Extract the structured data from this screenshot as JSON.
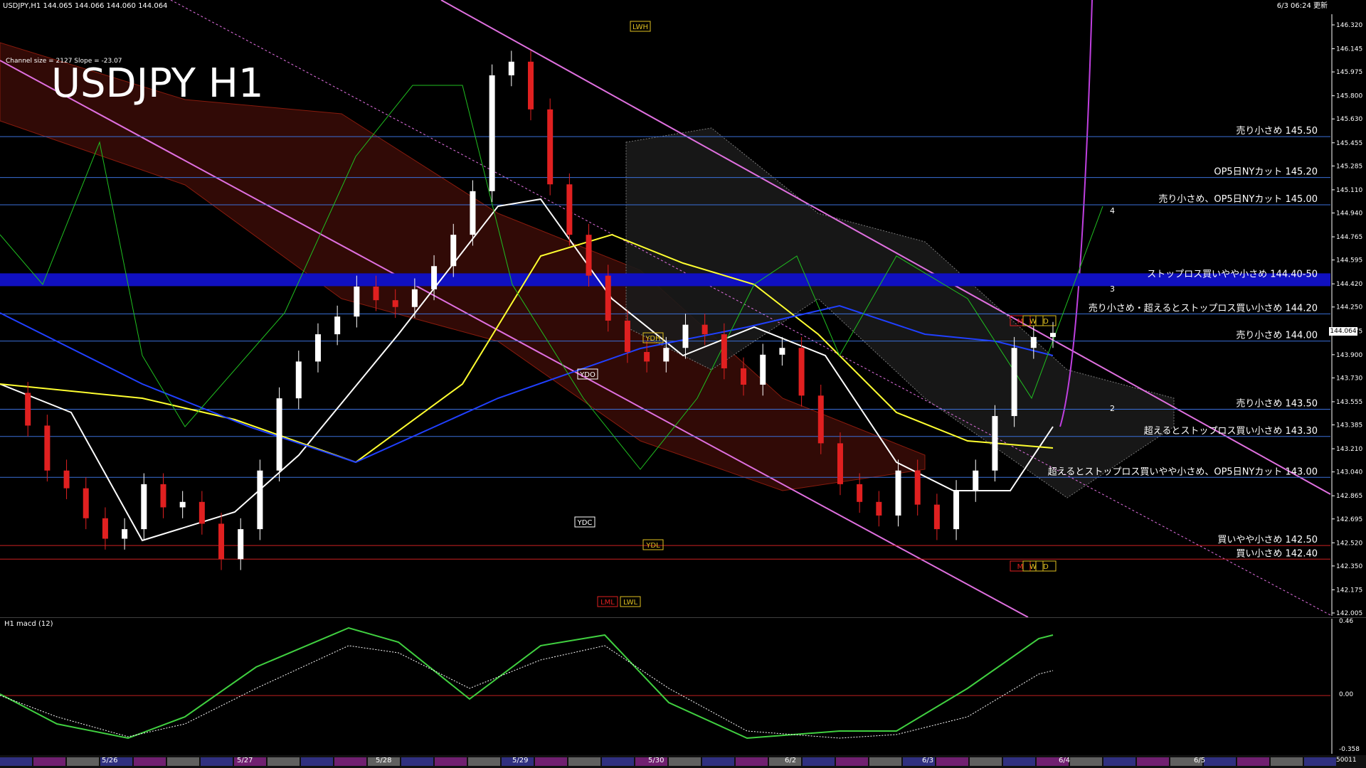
{
  "header": {
    "symbol_line": "USDJPY,H1  144.065 144.066 144.060 144.064",
    "datetime": "6/3 06:24 更新",
    "channel_info": "Channel size = 2127 Slope = -23.07",
    "big_title": "USDJPY H1"
  },
  "macd_panel": {
    "label": "H1  macd (12)",
    "scale": [
      "0.46",
      "0.00",
      "-0.358"
    ]
  },
  "price_badge": "144.064",
  "footer_code": "50011",
  "chart_data": {
    "type": "line",
    "title": "USDJPY H1",
    "y_ticks": [
      "146.320",
      "146.145",
      "145.975",
      "145.800",
      "145.630",
      "145.455",
      "145.285",
      "145.110",
      "144.940",
      "144.765",
      "144.595",
      "144.420",
      "144.250",
      "144.075",
      "143.900",
      "143.730",
      "143.555",
      "143.385",
      "143.210",
      "143.040",
      "142.865",
      "142.695",
      "142.520",
      "142.350",
      "142.175",
      "142.005"
    ],
    "ylim": [
      142.005,
      146.32
    ],
    "x_labels": [
      "5/26",
      "5/27",
      "5/28",
      "5/29",
      "5/30",
      "6/2",
      "6/3",
      "6/4",
      "6/5"
    ],
    "levels": [
      {
        "label": "売り小さめ 145.50",
        "value": 145.5,
        "color": "#3a6fd8"
      },
      {
        "label": "OP5日NYカット 145.20",
        "value": 145.2,
        "color": "#3a6fd8"
      },
      {
        "label": "売り小さめ、OP5日NYカット 145.00",
        "value": 145.0,
        "color": "#3a6fd8"
      },
      {
        "label": "ストップロス買いやや小さめ 144.40-50",
        "value": 144.45,
        "color": "#1a1ad8"
      },
      {
        "label": "売り小さめ・超えるとストップロス買い小さめ 144.20",
        "value": 144.2,
        "color": "#3a6fd8"
      },
      {
        "label": "売り小さめ 144.00",
        "value": 144.0,
        "color": "#3a6fd8"
      },
      {
        "label": "売り小さめ 143.50",
        "value": 143.5,
        "color": "#3a6fd8"
      },
      {
        "label": "超えるとストップロス買い小さめ 143.30",
        "value": 143.3,
        "color": "#3a6fd8"
      },
      {
        "label": "超えるとストップロス買いやや小さめ、OP5日NYカット 143.00",
        "value": 143.0,
        "color": "#3a6fd8"
      },
      {
        "label": "買いやや小さめ 142.50",
        "value": 142.5,
        "color": "#cc2020"
      },
      {
        "label": "買い小さめ 142.40",
        "value": 142.4,
        "color": "#cc2020"
      }
    ],
    "ref_boxes": [
      "LWH",
      "YDH",
      "YDO",
      "YDC",
      "YDL",
      "LML",
      "LWL",
      "M",
      "W",
      "D",
      "M",
      "W",
      "D"
    ],
    "fib_labels": [
      "4",
      "3",
      "2"
    ],
    "series": [
      {
        "name": "USDJPY",
        "values": [
          143.62,
          143.38,
          143.05,
          142.92,
          142.7,
          142.55,
          142.62,
          142.95,
          142.78,
          142.82,
          142.66,
          142.4,
          142.62,
          143.05,
          143.58,
          143.85,
          144.05,
          144.18,
          144.4,
          144.3,
          144.25,
          144.38,
          144.55,
          144.78,
          145.1,
          145.95,
          146.05,
          145.7,
          145.15,
          144.78,
          144.48,
          144.15,
          143.92,
          143.85,
          143.95,
          144.12,
          144.05,
          143.8,
          143.68,
          143.9,
          143.95,
          143.6,
          143.25,
          142.95,
          142.82,
          142.72,
          143.05,
          142.8,
          142.62,
          142.9,
          143.05,
          143.45,
          143.95,
          144.03,
          144.06
        ]
      }
    ],
    "macd": {
      "zero": 0.0,
      "ylim": [
        -0.358,
        0.46
      ]
    }
  }
}
